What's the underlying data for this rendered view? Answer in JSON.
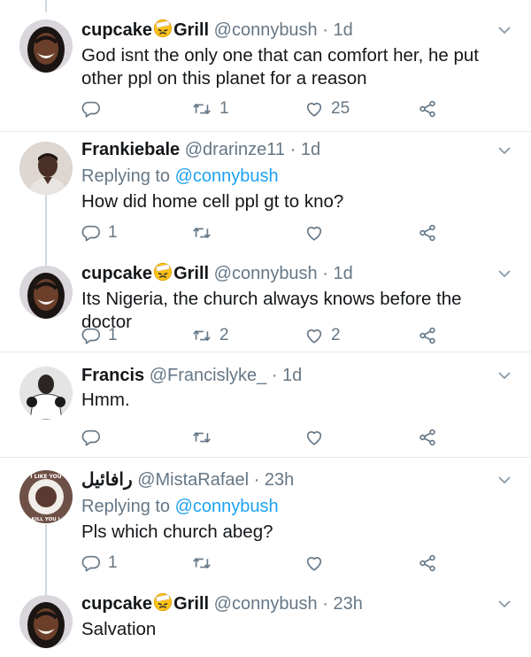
{
  "tweets": [
    {
      "name": "cupcake",
      "name_suffix": "Grill",
      "name_emoji": "face-with-head-bandage",
      "handle": "@connybush",
      "time": "· 1d",
      "reply_label": "",
      "reply_handle": "",
      "text": "God isnt the only one that can comfort her, he put other ppl on this planet for a reason",
      "replies": "",
      "retweets": "1",
      "likes": "25"
    },
    {
      "name": "Frankiebale",
      "name_suffix": "",
      "handle": "@drarinze11",
      "time": "· 1d",
      "reply_label": "Replying to",
      "reply_handle": "@connybush",
      "text": "How did home cell ppl gt to kno?",
      "replies": "1",
      "retweets": "",
      "likes": ""
    },
    {
      "name": "cupcake",
      "name_suffix": "Grill",
      "name_emoji": "face-with-head-bandage",
      "handle": "@connybush",
      "time": "· 1d",
      "reply_label": "",
      "reply_handle": "",
      "text": "Its Nigeria, the church always knows before the doctor",
      "replies": "1",
      "retweets": "2",
      "likes": "2"
    },
    {
      "name": "Francis",
      "name_suffix": "",
      "handle": "@Francislyke_",
      "time": "· 1d",
      "reply_label": "",
      "reply_handle": "",
      "text": "Hmm.",
      "replies": "",
      "retweets": "",
      "likes": ""
    },
    {
      "name": "رافائيل",
      "name_suffix": "",
      "handle": "@MistaRafael",
      "time": "· 23h",
      "reply_label": "Replying to",
      "reply_handle": "@connybush",
      "text": "Pls which church abeg?",
      "replies": "1",
      "retweets": "",
      "likes": "",
      "avatar_text_top": "I LIKE YOU",
      "avatar_text_bottom": "I'LL KILL YOU LAST"
    },
    {
      "name": "cupcake",
      "name_suffix": "Grill",
      "name_emoji": "face-with-head-bandage",
      "handle": "@connybush",
      "time": "· 23h",
      "reply_label": "",
      "reply_handle": "",
      "text": "Salvation",
      "replies": "",
      "retweets": "",
      "likes": ""
    }
  ],
  "colors": {
    "name": "#14171a",
    "meta": "#657786",
    "link": "#1da1f2",
    "divider": "#e1e8ed",
    "thread_line": "#cfd9de"
  },
  "icons": [
    "reply-icon",
    "retweet-icon",
    "like-icon",
    "share-icon",
    "chevron-down-icon"
  ]
}
